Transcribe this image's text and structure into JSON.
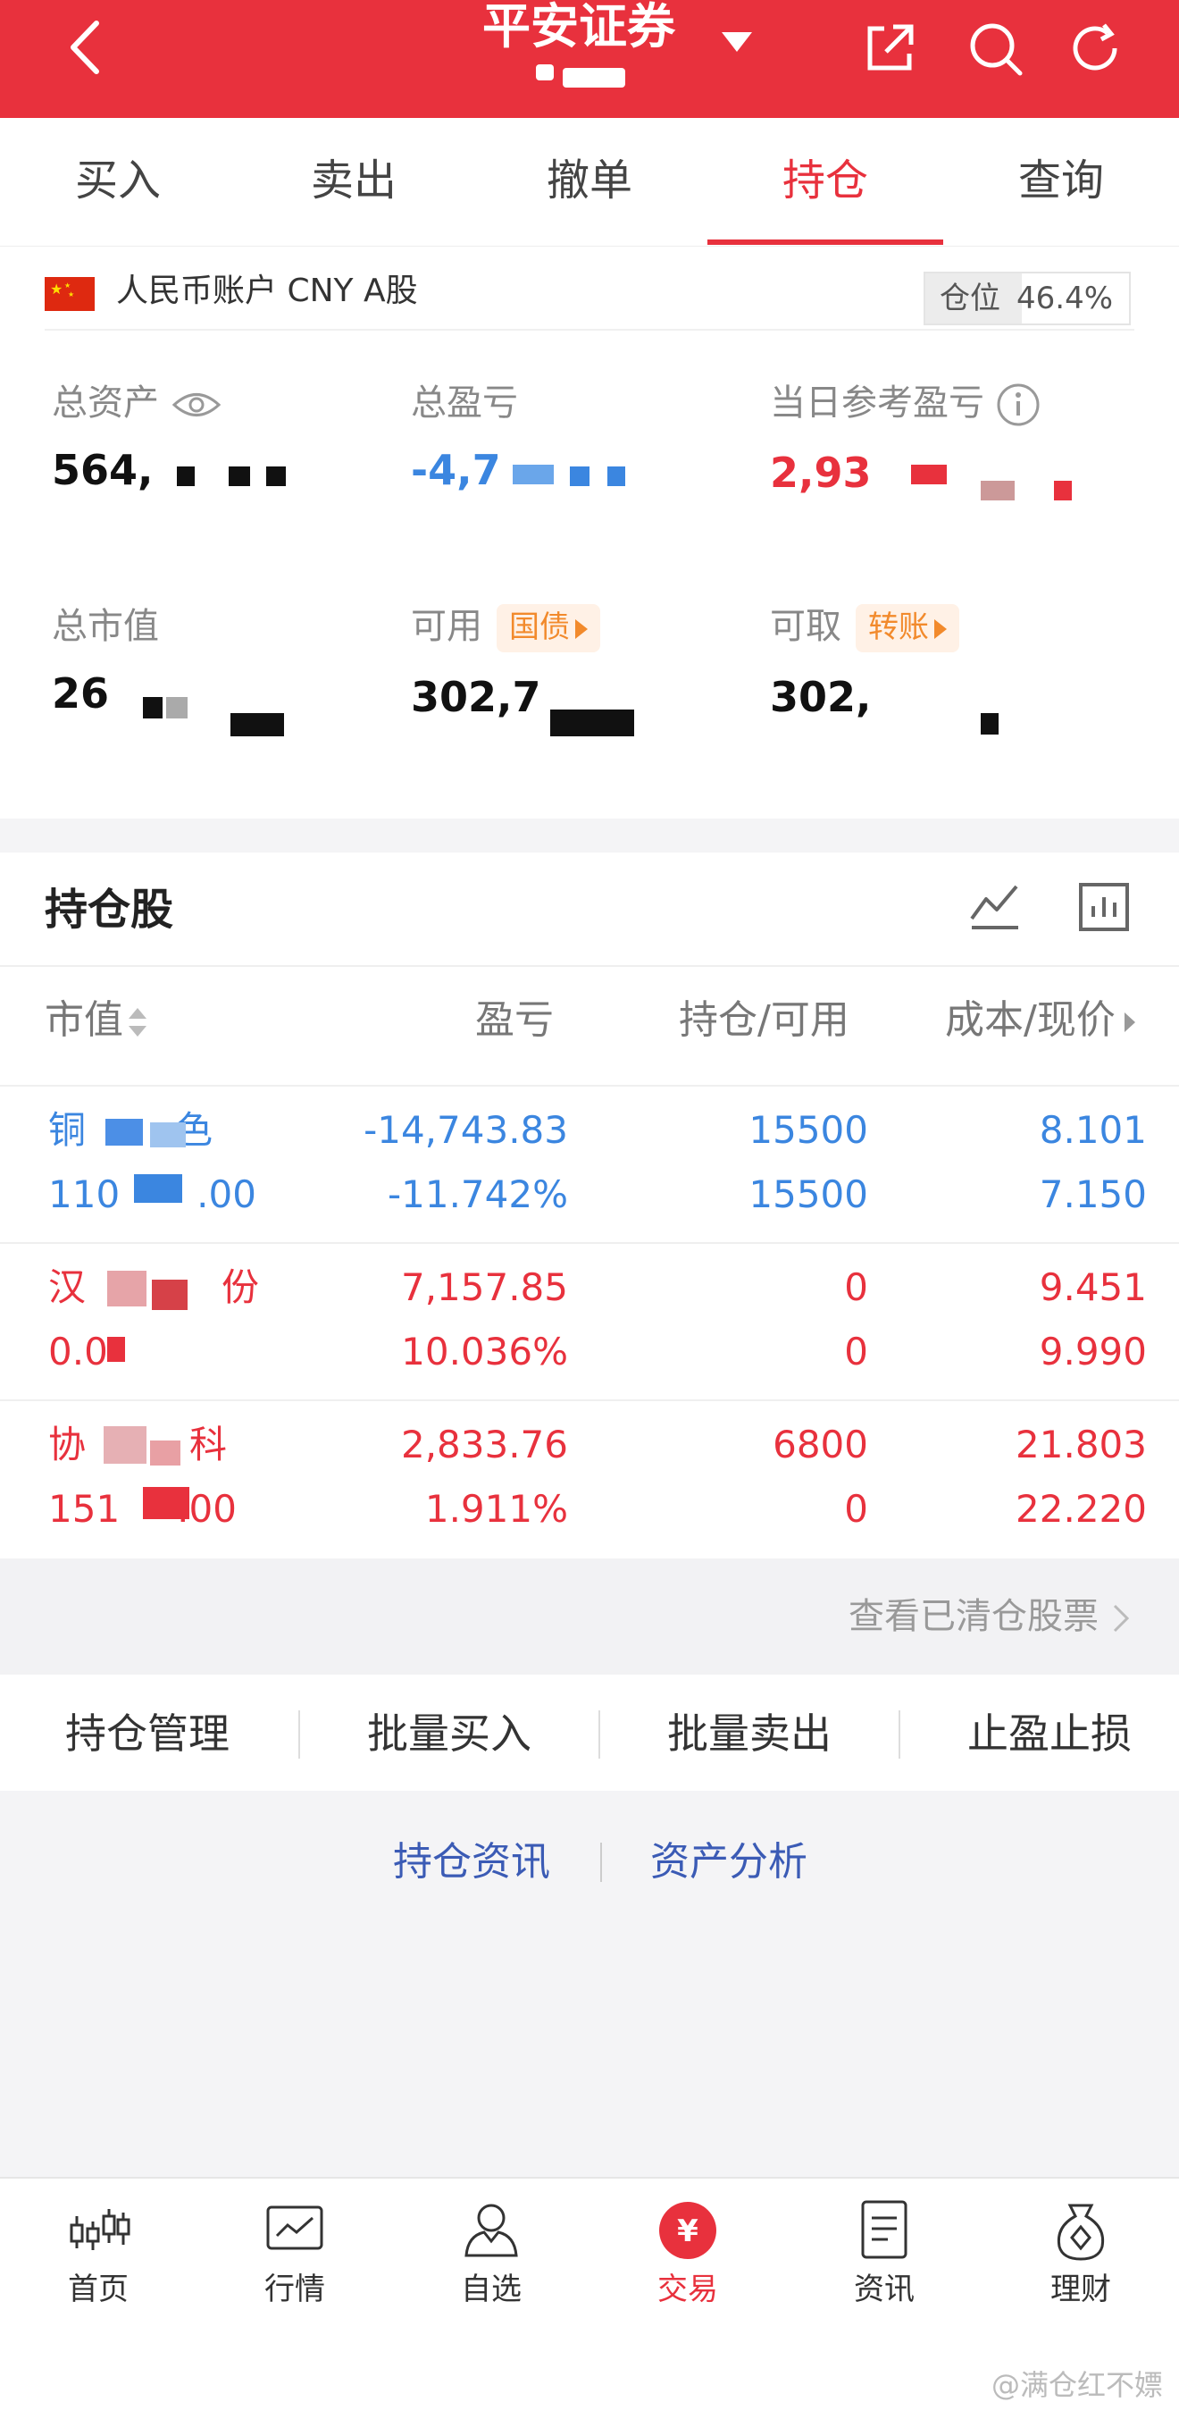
{
  "header": {
    "title": "平安证券",
    "icons": [
      "back-icon",
      "dropdown-caret-icon",
      "share-icon",
      "search-icon",
      "refresh-icon"
    ],
    "bg_color": "#e8313d"
  },
  "tabs": [
    {
      "label": "买入"
    },
    {
      "label": "卖出"
    },
    {
      "label": "撤单"
    },
    {
      "label": "持仓",
      "active": true
    },
    {
      "label": "查询"
    }
  ],
  "account": {
    "label": "人民币账户 CNY A股",
    "position_label": "仓位",
    "position_value": "46.4%",
    "total_assets_label": "总资产",
    "total_assets_value": "564,",
    "total_pnl_label": "总盈亏",
    "total_pnl_value": "-4,7",
    "daily_pnl_label": "当日参考盈亏",
    "daily_pnl_value": "2,93",
    "market_value_label": "总市值",
    "market_value_value": "26",
    "available_label": "可用",
    "available_tag": "国债",
    "available_value": "302,7",
    "withdrawable_label": "可取",
    "withdrawable_tag": "转账",
    "withdrawable_value": "302,"
  },
  "holdings": {
    "title": "持仓股",
    "columns": [
      "市值",
      "盈亏",
      "持仓/可用",
      "成本/现价"
    ],
    "rows": [
      {
        "name": "铜",
        "name_suffix": "色",
        "market_value": "110",
        "market_value_suffix": ".00",
        "pnl": "-14,743.83",
        "pnl_pct": "-11.742%",
        "holding": "15500",
        "available": "15500",
        "cost": "8.101",
        "price": "7.150",
        "color": "blue"
      },
      {
        "name": "汉",
        "name_suffix": "份",
        "market_value": "0.0",
        "market_value_suffix": "",
        "pnl": "7,157.85",
        "pnl_pct": "10.036%",
        "holding": "0",
        "available": "0",
        "cost": "9.451",
        "price": "9.990",
        "color": "red"
      },
      {
        "name": "协",
        "name_suffix": "科",
        "market_value": "151",
        "market_value_suffix": ".00",
        "pnl": "2,833.76",
        "pnl_pct": "1.911%",
        "holding": "6800",
        "available": "0",
        "cost": "21.803",
        "price": "22.220",
        "color": "red"
      }
    ],
    "cleared_link": "查看已清仓股票"
  },
  "actions": [
    "持仓管理",
    "批量买入",
    "批量卖出",
    "止盈止损"
  ],
  "links": [
    "持仓资讯",
    "资产分析"
  ],
  "bottom_nav": [
    {
      "label": "首页",
      "icon": "candlestick-icon"
    },
    {
      "label": "行情",
      "icon": "chart-icon"
    },
    {
      "label": "自选",
      "icon": "person-icon"
    },
    {
      "label": "交易",
      "icon": "yuan-icon",
      "active": true
    },
    {
      "label": "资讯",
      "icon": "document-icon"
    },
    {
      "label": "理财",
      "icon": "money-bag-icon"
    }
  ],
  "watermark": "@满仓红不嫖"
}
